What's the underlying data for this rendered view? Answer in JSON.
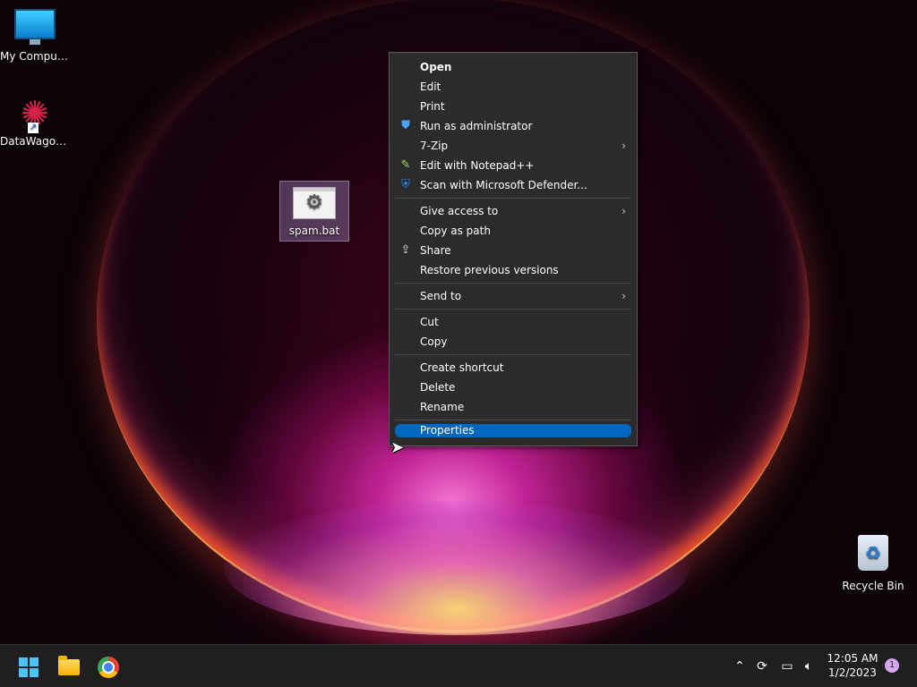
{
  "desktop": {
    "icons": [
      {
        "label": "My Computer"
      },
      {
        "label": "DataWagon..."
      },
      {
        "label": "spam.bat"
      },
      {
        "label": "Recycle Bin"
      }
    ]
  },
  "context_menu": {
    "items": [
      {
        "label": "Open"
      },
      {
        "label": "Edit"
      },
      {
        "label": "Print"
      },
      {
        "label": "Run as administrator",
        "icon": "shield-icon"
      },
      {
        "label": "7-Zip",
        "submenu": true
      },
      {
        "label": "Edit with Notepad++",
        "icon": "notepadpp-icon"
      },
      {
        "label": "Scan with Microsoft Defender...",
        "icon": "defender-icon"
      },
      {
        "label": "Give access to",
        "submenu": true
      },
      {
        "label": "Copy as path"
      },
      {
        "label": "Share",
        "icon": "share-icon"
      },
      {
        "label": "Restore previous versions"
      },
      {
        "label": "Send to",
        "submenu": true
      },
      {
        "label": "Cut"
      },
      {
        "label": "Copy"
      },
      {
        "label": "Create shortcut"
      },
      {
        "label": "Delete"
      },
      {
        "label": "Rename"
      },
      {
        "label": "Properties"
      }
    ],
    "chevron": "›"
  },
  "taskbar": {
    "clock_time": "12:05 AM",
    "clock_date": "1/2/2023",
    "notification_count": "1"
  },
  "colors": {
    "menu_bg": "#2b2b2b",
    "highlight": "#0067c0",
    "taskbar_bg": "#1f1f1f"
  }
}
